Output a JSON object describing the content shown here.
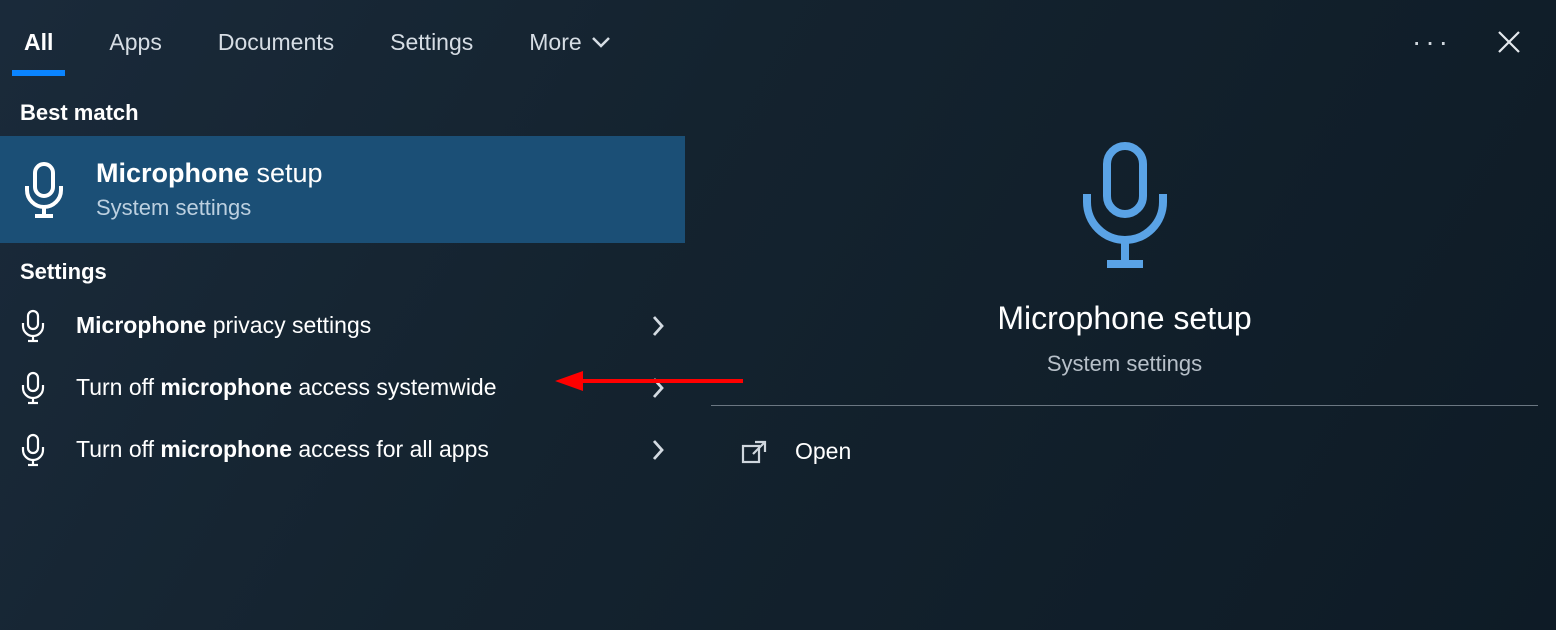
{
  "tabs": {
    "all": "All",
    "apps": "Apps",
    "documents": "Documents",
    "settings": "Settings",
    "more": "More"
  },
  "left": {
    "best_match_label": "Best match",
    "best_match": {
      "title_bold": "Microphone",
      "title_rest": " setup",
      "subtitle": "System settings"
    },
    "settings_label": "Settings",
    "items": [
      {
        "bold": "Microphone",
        "rest": " privacy settings"
      },
      {
        "pre": "Turn off ",
        "bold": "microphone",
        "rest": " access systemwide"
      },
      {
        "pre": "Turn off ",
        "bold": "microphone",
        "rest": " access for all apps"
      }
    ]
  },
  "right": {
    "title": "Microphone setup",
    "subtitle": "System settings",
    "open_label": "Open"
  },
  "colors": {
    "accent": "#0a84ff",
    "highlight_row": "#1b4f76",
    "mic_blue": "#5aa3e6"
  }
}
